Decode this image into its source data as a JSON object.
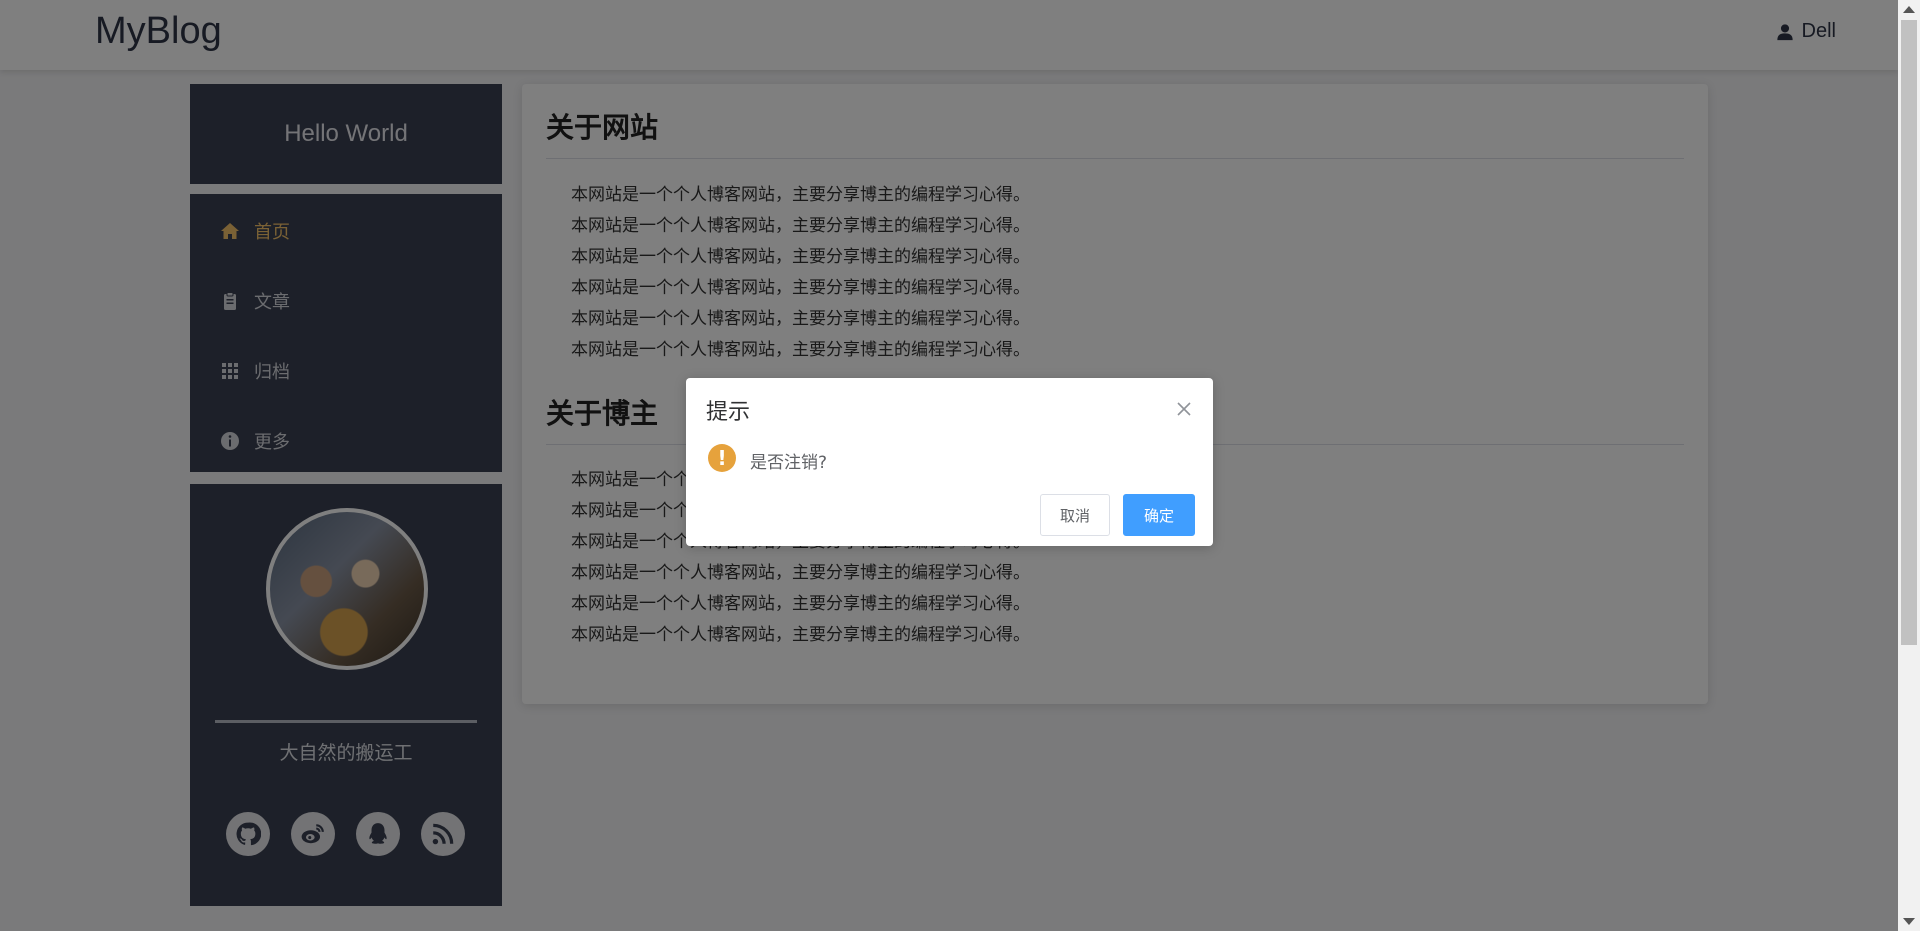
{
  "header": {
    "logo": "MyBlog",
    "user": "Dell"
  },
  "sidebar": {
    "hello": "Hello World",
    "menu": [
      {
        "label": "首页",
        "icon": "home-icon",
        "active": true
      },
      {
        "label": "文章",
        "icon": "clipboard-icon",
        "active": false
      },
      {
        "label": "归档",
        "icon": "grid-icon",
        "active": false
      },
      {
        "label": "更多",
        "icon": "info-icon",
        "active": false
      }
    ],
    "profile": {
      "nickname": "大自然的搬运工",
      "socials": [
        "github-icon",
        "weibo-icon",
        "qq-icon",
        "rss-icon"
      ]
    }
  },
  "main": {
    "sections": [
      {
        "title": "关于网站",
        "lines": [
          "本网站是一个个人博客网站，主要分享博主的编程学习心得。",
          "本网站是一个个人博客网站，主要分享博主的编程学习心得。",
          "本网站是一个个人博客网站，主要分享博主的编程学习心得。",
          "本网站是一个个人博客网站，主要分享博主的编程学习心得。",
          "本网站是一个个人博客网站，主要分享博主的编程学习心得。",
          "本网站是一个个人博客网站，主要分享博主的编程学习心得。"
        ]
      },
      {
        "title": "关于博主",
        "lines": [
          "本网站是一个个人博客网站，主要分享博主的编程学习心得。",
          "本网站是一个个人博客网站，主要分享博主的编程学习心得。",
          "本网站是一个个人博客网站，主要分享博主的编程学习心得。",
          "本网站是一个个人博客网站，主要分享博主的编程学习心得。",
          "本网站是一个个人博客网站，主要分享博主的编程学习心得。",
          "本网站是一个个人博客网站，主要分享博主的编程学习心得。"
        ]
      }
    ]
  },
  "dialog": {
    "title": "提示",
    "message": "是否注销?",
    "cancel": "取消",
    "confirm": "确定"
  },
  "colors": {
    "sidebar_bg": "#3b4152",
    "active_menu": "#f5c26b",
    "primary_button": "#409eff",
    "warning_icon": "#e6a23c"
  }
}
